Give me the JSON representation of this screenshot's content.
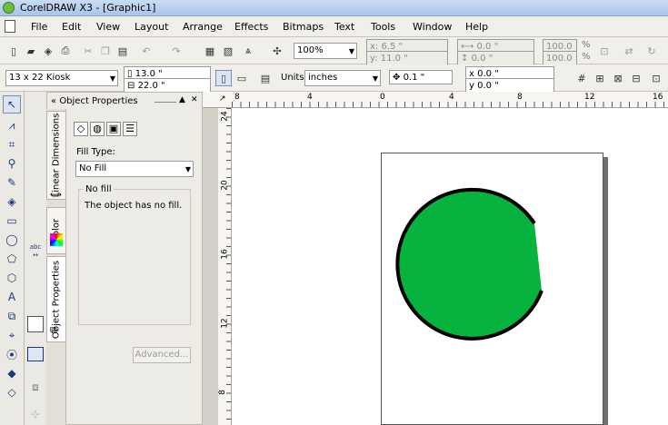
{
  "window": {
    "title": "CorelDRAW X3 - [Graphic1]"
  },
  "menu": [
    "File",
    "Edit",
    "View",
    "Layout",
    "Arrange",
    "Effects",
    "Bitmaps",
    "Text",
    "Tools",
    "Window",
    "Help"
  ],
  "toolbar": {
    "zoom": "100%",
    "x": "6.5 \"",
    "y": "11.0 \"",
    "w": "0.0 \"",
    "h": "0.0 \"",
    "scale_x": "100.0",
    "scale_y": "100.0",
    "pct1": "%",
    "pct2": "%"
  },
  "property_bar": {
    "page_size": "13 x 22 Kiosk",
    "page_width": "13.0 \"",
    "page_height": "22.0 \"",
    "units_label": "Units:",
    "units": "inches",
    "nudge": "0.1 \"",
    "dup_x": "0.0 \"",
    "dup_y": "0.0 \""
  },
  "docker": {
    "title": "Object Properties",
    "fill_type_label": "Fill Type:",
    "fill_type": "No Fill",
    "group_label": "No fill",
    "description": "The object has no fill.",
    "advanced_button": "Advanced...",
    "tabs": [
      "Linear Dimensions",
      "Color",
      "Object Properties"
    ]
  },
  "ruler_top_labels": [
    "8",
    "4",
    "0",
    "4",
    "8",
    "12",
    "16"
  ],
  "ruler_left_labels": [
    "24",
    "20",
    "16",
    "12",
    "8"
  ],
  "ruler_corner": "↗"
}
